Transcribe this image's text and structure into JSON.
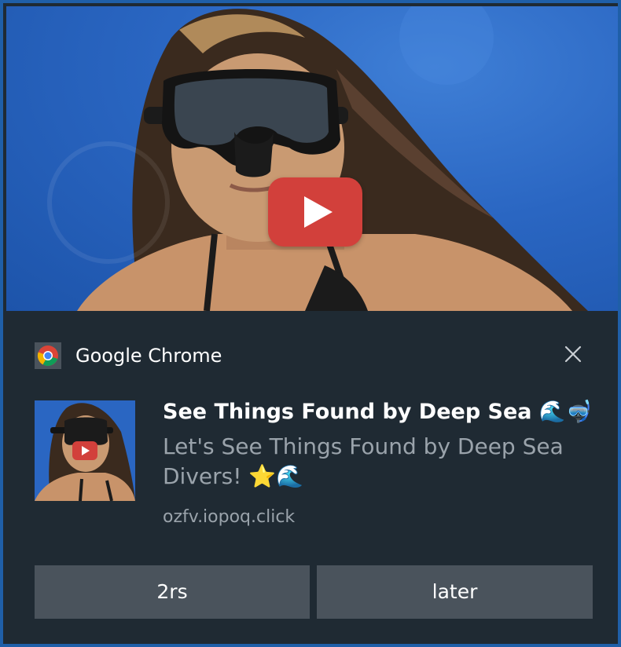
{
  "notification": {
    "app_name": "Google Chrome",
    "title": "See Things Found by Deep Sea 🌊🤿",
    "message": "Let's See Things Found by Deep Sea Divers! ⭐🌊",
    "source": "ozfv.iopoq.click"
  },
  "actions": [
    {
      "label": "2rs"
    },
    {
      "label": "later"
    }
  ],
  "icons": {
    "app": "chrome-logo-icon",
    "close": "close-icon",
    "play": "play-icon"
  },
  "colors": {
    "background": "#1f2a33",
    "border": "#1f5fa8",
    "button": "#4a535c",
    "secondary_text": "#9aa3ab",
    "play_red": "#d2403b",
    "water_blue": "#2a66c2"
  }
}
